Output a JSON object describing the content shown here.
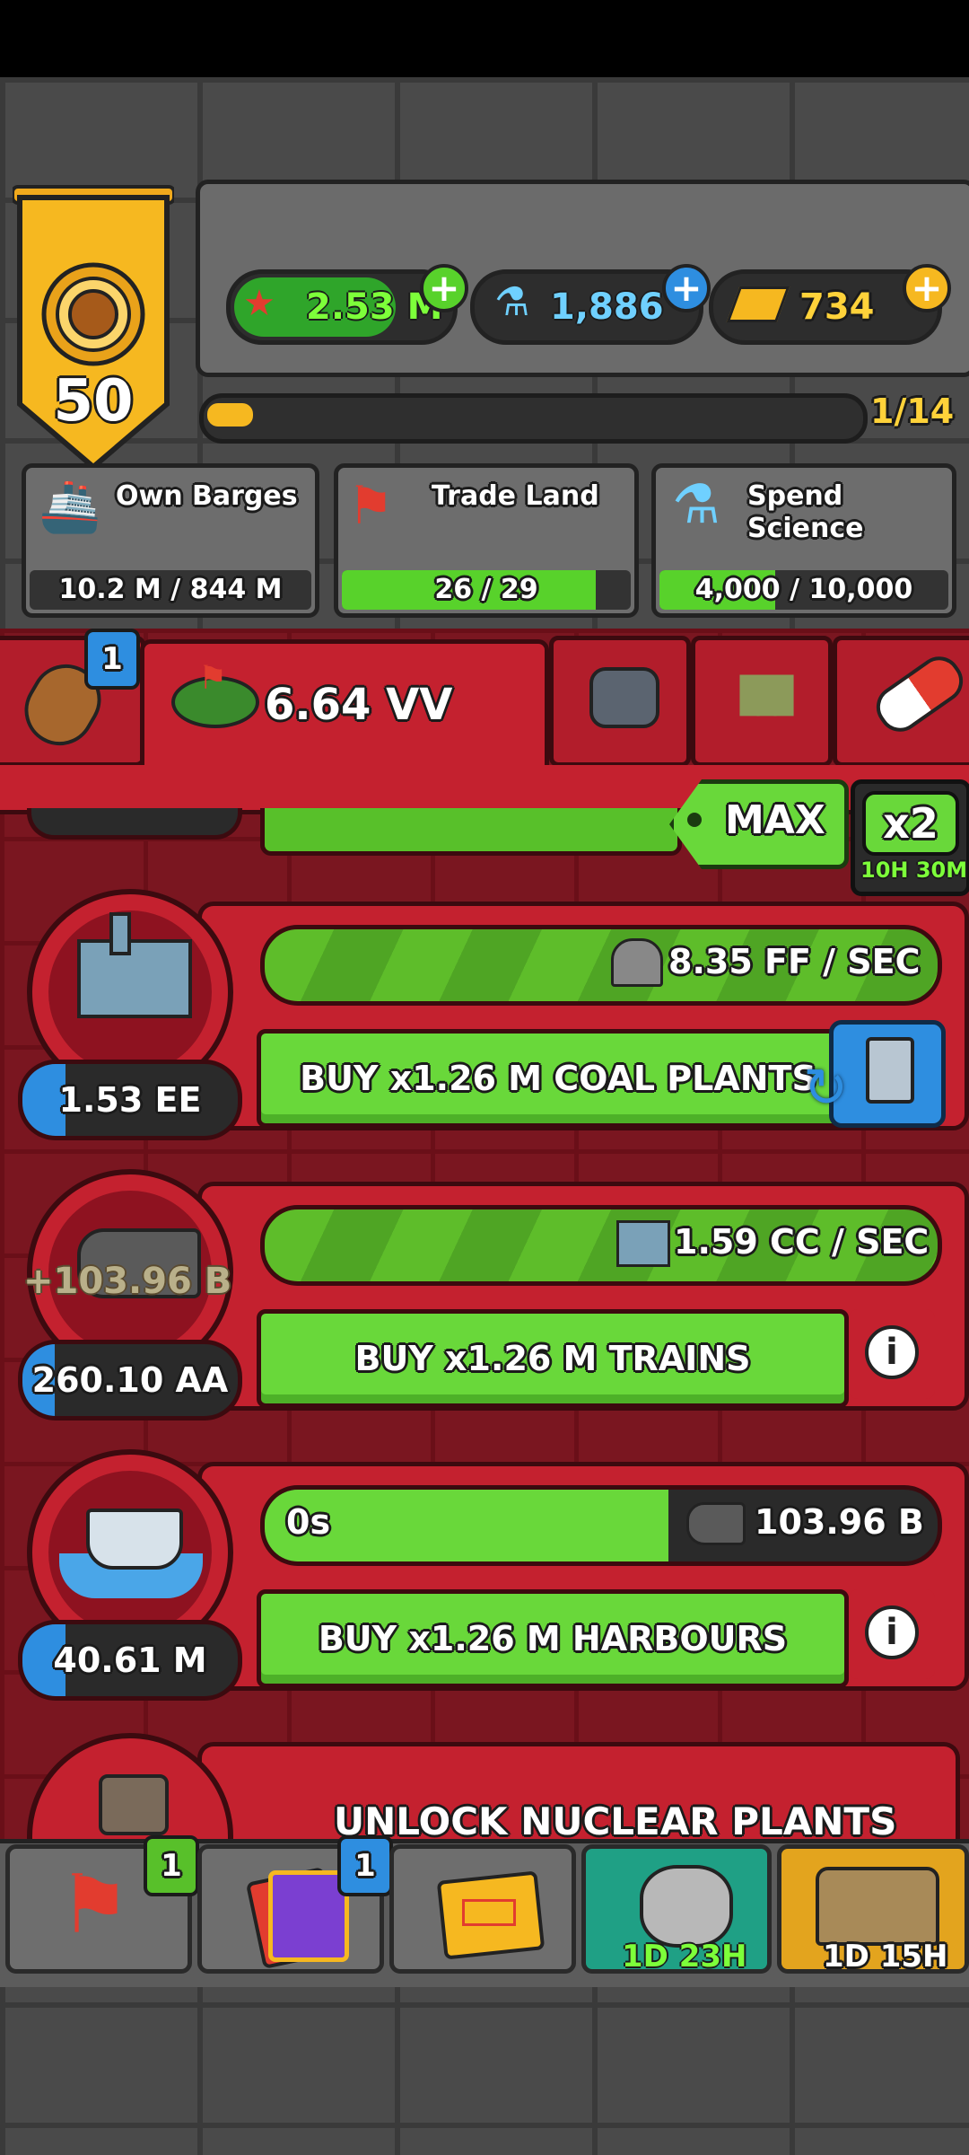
{
  "player": {
    "level": "50"
  },
  "currencies": [
    {
      "name": "cash",
      "value": "2.53 M",
      "icon": "cash-cap-icon"
    },
    {
      "name": "science",
      "value": "1,886",
      "icon": "flask-icon"
    },
    {
      "name": "gold",
      "value": "734",
      "icon": "gold-bars-icon"
    }
  ],
  "xp": {
    "progress_text": "1/14",
    "fraction": 0.07
  },
  "quests": [
    {
      "title": "Own Barges",
      "progress": "10.2 M / 844 M",
      "fraction": 0.0
    },
    {
      "title": "Trade Land",
      "progress": "26 / 29",
      "fraction": 0.88
    },
    {
      "title": "Spend Science",
      "progress": "4,000 / 10,000",
      "fraction": 0.4
    }
  ],
  "resource_tab": {
    "badge": "1",
    "land_value": "6.64 VV"
  },
  "multiplier": {
    "max_label": "MAX",
    "boost_label": "x2",
    "boost_timer": "10H 30M"
  },
  "producers": [
    {
      "name": "coal-plants",
      "rate": "8.35 FF / SEC",
      "buy_label": "BUY x1.26 M COAL PLANTS",
      "owned": "1.53 EE",
      "progress": 1.0,
      "owned_fill": 0.2
    },
    {
      "name": "trains",
      "rate": "1.59 CC / SEC",
      "buy_label": "BUY x1.26 M TRAINS",
      "owned": "260.10 AA",
      "floating_income": "+103.96 B",
      "progress": 1.0,
      "owned_fill": 0.15
    },
    {
      "name": "harbours",
      "timer": "0s",
      "rate": "103.96 B",
      "buy_label": "BUY x1.26 M HARBOURS",
      "owned": "40.61 M",
      "progress": 0.6,
      "owned_fill": 0.2
    }
  ],
  "locked": {
    "label": "UNLOCK NUCLEAR PLANTS"
  },
  "bottom_nav": [
    {
      "name": "trade-land",
      "badge": "1"
    },
    {
      "name": "cards",
      "badge": "1"
    },
    {
      "name": "secret-files",
      "badge": ""
    },
    {
      "name": "moon-mission",
      "timer": "1D 23H"
    },
    {
      "name": "chests",
      "timer": "1D 15H"
    }
  ],
  "colors": {
    "accent_green": "#69d83a",
    "red_panel": "#c4212f",
    "gold": "#f6b820",
    "blue": "#2e8ee0"
  }
}
